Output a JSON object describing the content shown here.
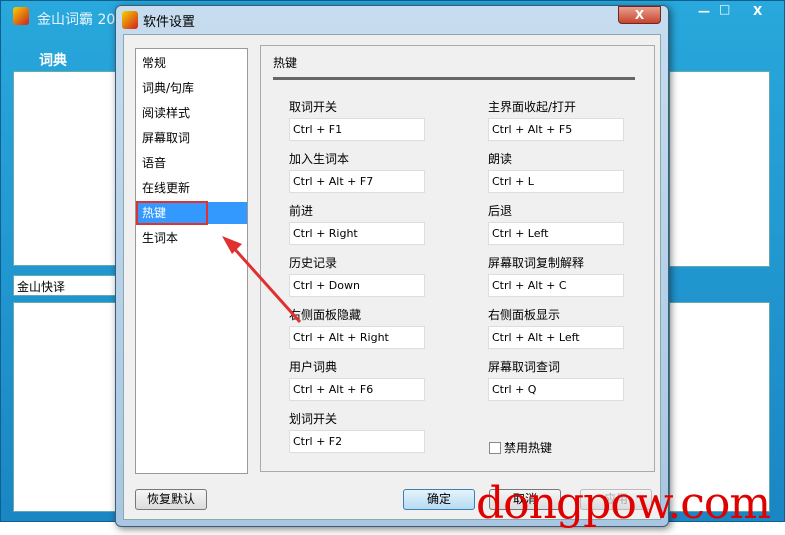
{
  "main_window": {
    "title": "金山词霸 20",
    "dict_label": "词典",
    "dropdown_value": "金山快译",
    "controls": {
      "minimize": "—",
      "maximize": "□",
      "close": "X"
    }
  },
  "dialog": {
    "title": "软件设置",
    "close": "X",
    "nav": [
      "常规",
      "词典/句库",
      "阅读样式",
      "屏幕取词",
      "语音",
      "在线更新",
      "热键",
      "生词本"
    ],
    "selected_nav": "热键",
    "group_title": "热键",
    "left_hotkeys": [
      {
        "label": "取词开关",
        "value": "Ctrl + F1"
      },
      {
        "label": "加入生词本",
        "value": "Ctrl + Alt + F7"
      },
      {
        "label": "前进",
        "value": "Ctrl + Right"
      },
      {
        "label": "历史记录",
        "value": "Ctrl + Down"
      },
      {
        "label": "右侧面板隐藏",
        "value": "Ctrl + Alt + Right"
      },
      {
        "label": "用户词典",
        "value": "Ctrl + Alt + F6"
      },
      {
        "label": "划词开关",
        "value": "Ctrl + F2"
      }
    ],
    "right_hotkeys": [
      {
        "label": "主界面收起/打开",
        "value": "Ctrl + Alt + F5"
      },
      {
        "label": "朗读",
        "value": "Ctrl + L"
      },
      {
        "label": "后退",
        "value": "Ctrl + Left"
      },
      {
        "label": "屏幕取词复制解释",
        "value": "Ctrl + Alt + C"
      },
      {
        "label": "右侧面板显示",
        "value": "Ctrl + Alt + Left"
      },
      {
        "label": "屏幕取词查词",
        "value": "Ctrl + Q"
      }
    ],
    "disable_hotkeys_label": "禁用热键",
    "disable_hotkeys_checked": false,
    "buttons": {
      "restore": "恢复默认",
      "ok": "确定",
      "cancel": "取消",
      "apply": "应用"
    }
  },
  "watermark": "dongpow.com",
  "colors": {
    "selection": "#3399ff",
    "highlight_box": "#e03030",
    "arrow": "#e03030"
  }
}
